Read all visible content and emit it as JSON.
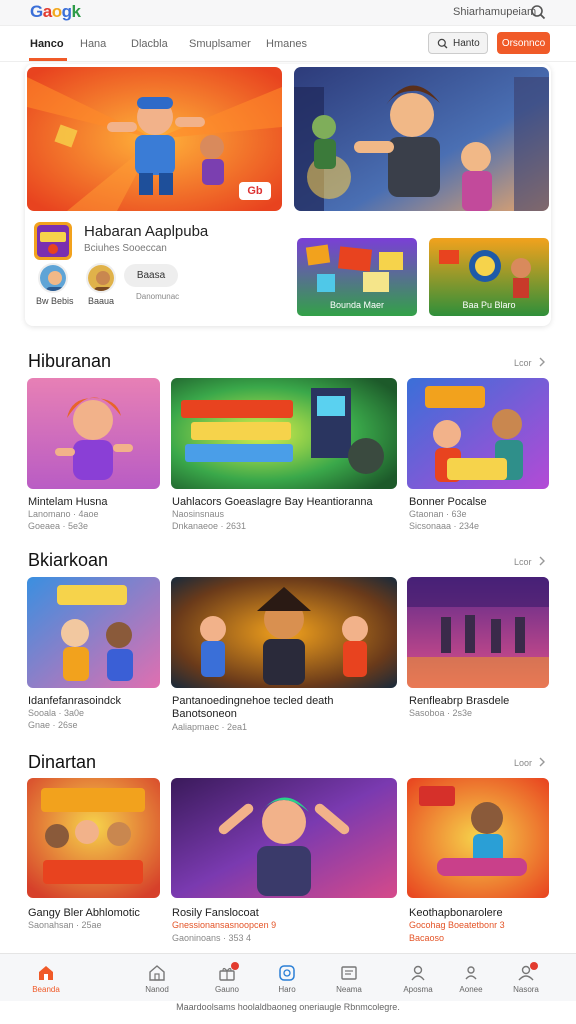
{
  "header": {
    "logo": [
      "G",
      "a",
      "o",
      "g",
      "k"
    ],
    "account_text": "Shiarhamupeiam"
  },
  "nav": {
    "tabs": [
      "Hanco",
      "Hana",
      "Dlacbla",
      "Smuplsamer",
      "Hmanes"
    ],
    "search_label": "Hanto",
    "cta_label": "Orsonnco"
  },
  "hero": {
    "badge": "Gb",
    "app_title": "Habaran Aaplpuba",
    "app_subtitle": "Bciuhes Sooeccan",
    "avatars": [
      {
        "label": "Bw Bebis"
      },
      {
        "label": "Baaua"
      }
    ],
    "pill_label": "Baasa",
    "meta": "Danomunac",
    "minis": [
      {
        "label": "Bounda Maer"
      },
      {
        "label": "Baa Pu Blaro"
      }
    ]
  },
  "sections": [
    {
      "title": "Hiburanan",
      "more": "Lcor",
      "cards": [
        {
          "title": "Mintelam Husna",
          "meta1": "Lanomano · 4aoe",
          "meta2": "Goeaea · 5e3e"
        },
        {
          "title": "Uahlacors Goeaslagre Bay Heantioranna",
          "meta1": "Naosinsnaus",
          "meta2": "Dnkanaeoe · 2631"
        },
        {
          "title": "Bonner Pocalse",
          "meta1": "Gtaonan · 63e",
          "meta2": "Sicsonaaa · 234e"
        }
      ]
    },
    {
      "title": "Bkiarkoan",
      "more": "Lcor",
      "cards": [
        {
          "title": "Idanfefanrasoindck",
          "meta1": "Sooala · 3a0e",
          "meta2": "Gnae · 26se"
        },
        {
          "title": "Pantanoedingnehoe tecled death",
          "meta1": "Banotsoneon",
          "meta2": "Aaliapmaec · 2ea1"
        },
        {
          "title": "Renfleabrp Brasdele",
          "meta1": "Sasoboa · 2s3e",
          "meta2": ""
        }
      ]
    },
    {
      "title": "Dinartan",
      "more": "Loor",
      "cards": [
        {
          "title": "Gangy Bler Abhlomotic",
          "meta1": "Saonahsan · 25ae",
          "meta2": ""
        },
        {
          "title": "Rosily Fanslocoat",
          "meta1": "Gnessionansasnoopcen 9",
          "meta2": "Gaoninoans · 353 4"
        },
        {
          "title": "Keothapbonarolere",
          "meta1": "Gocohag Boeatetbonr 3",
          "meta2": "Bacaoso"
        }
      ]
    }
  ],
  "bottom_nav": [
    {
      "label": "Beanda",
      "icon": "home-icon",
      "active": true
    },
    {
      "label": "Nanod",
      "icon": "store-icon"
    },
    {
      "label": "Gauno",
      "icon": "gift-icon",
      "badge": true
    },
    {
      "label": "Haro",
      "icon": "timer-icon"
    },
    {
      "label": "Neama",
      "icon": "inbox-icon"
    },
    {
      "label": "Aposma",
      "icon": "person-icon"
    },
    {
      "label": "Aonee",
      "icon": "user-icon"
    },
    {
      "label": "Nasora",
      "icon": "people-icon",
      "badge": true
    }
  ],
  "footer": "Maardoolsams hoolaldbaoneg oneriaugle Rbnmcolegre.",
  "colors": {
    "accent": "#f05a28",
    "red": "#e23b2f"
  }
}
